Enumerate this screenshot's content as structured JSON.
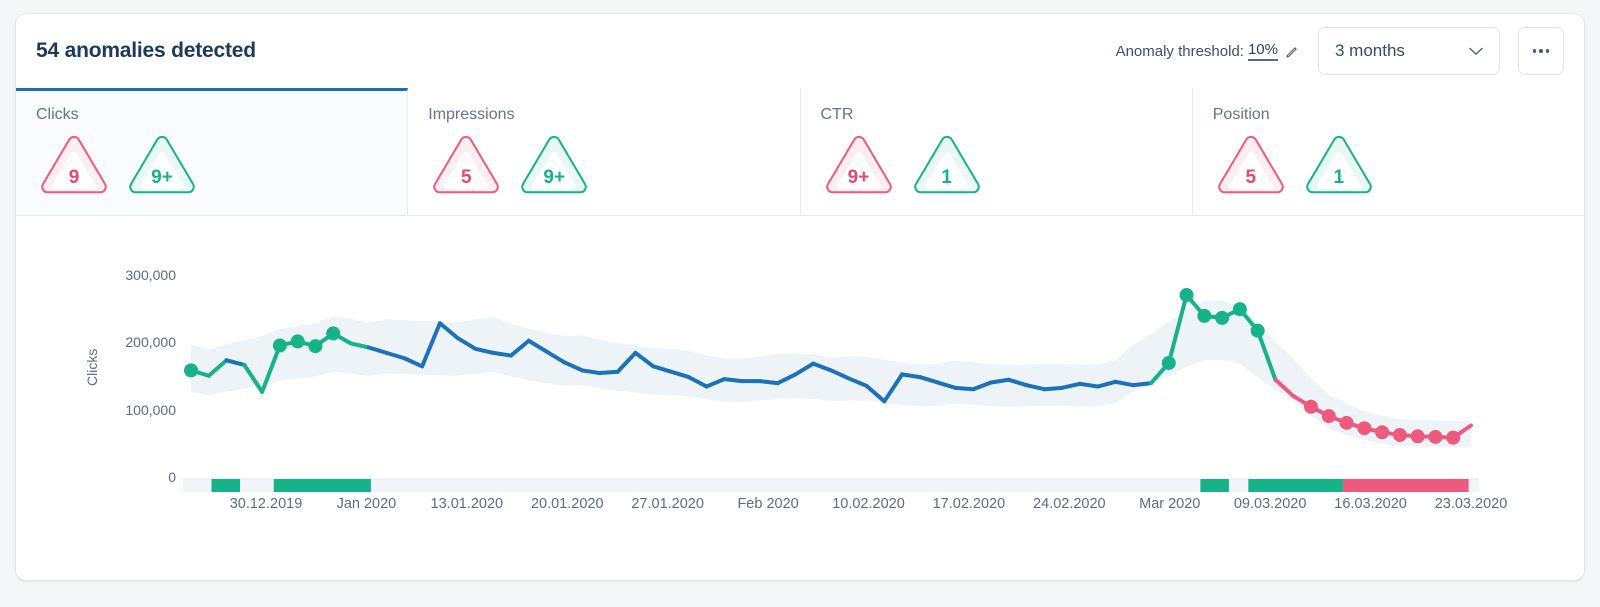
{
  "header": {
    "title": "54 anomalies detected",
    "threshold_label": "Anomaly threshold:",
    "threshold_value": "10%",
    "edit_icon": "pencil-icon",
    "period": "3 months",
    "period_caret": "chevron-down-icon",
    "more_icon": "ellipsis-icon"
  },
  "tabs": [
    {
      "label": "Clicks",
      "active": true,
      "down": "9",
      "up": "9+"
    },
    {
      "label": "Impressions",
      "active": false,
      "down": "5",
      "up": "9+"
    },
    {
      "label": "CTR",
      "active": false,
      "down": "9+",
      "up": "1"
    },
    {
      "label": "Position",
      "active": false,
      "down": "5",
      "up": "1"
    }
  ],
  "colors": {
    "line": "#1b72b8",
    "anomaly_up": "#16b288",
    "anomaly_down": "#ee5a7d",
    "band": "#eef3f8",
    "accent": "#1b6eb4",
    "title": "#1b3a5c"
  },
  "chart_data": {
    "type": "line",
    "title": "",
    "xlabel": "",
    "ylabel": "Clicks",
    "ylim": [
      0,
      330000
    ],
    "yticks": [
      0,
      100000,
      200000,
      300000
    ],
    "ytick_labels": [
      "0",
      "100,000",
      "200,000",
      "300,000"
    ],
    "xtick_labels": [
      "30.12.2019",
      "Jan 2020",
      "13.01.2020",
      "20.01.2020",
      "27.01.2020",
      "Feb 2020",
      "10.02.2020",
      "17.02.2020",
      "24.02.2020",
      "Mar 2020",
      "09.03.2020",
      "16.03.2020",
      "23.03.2020"
    ],
    "grid": false,
    "legend": null,
    "series": [
      {
        "name": "Clicks",
        "values": [
          160000,
          152000,
          175000,
          168000,
          128000,
          197000,
          203000,
          196000,
          215000,
          200000,
          194000,
          186000,
          178000,
          166000,
          230000,
          208000,
          192000,
          186000,
          182000,
          204000,
          188000,
          172000,
          160000,
          156000,
          158000,
          186000,
          166000,
          158000,
          150000,
          136000,
          147000,
          144000,
          144000,
          141000,
          154000,
          170000,
          160000,
          148000,
          137000,
          114000,
          154000,
          150000,
          142000,
          134000,
          132000,
          142000,
          146000,
          138000,
          132000,
          134000,
          140000,
          136000,
          143000,
          138000,
          141000,
          171000,
          272000,
          241000,
          238000,
          251000,
          219000,
          146000,
          122000,
          106000,
          92000,
          82000,
          74000,
          68000,
          64000,
          62000,
          61000,
          60000,
          78000
        ]
      }
    ],
    "band": {
      "name": "expected range",
      "description": "light shaded forecast band behind the line"
    },
    "anomaly_segments": [
      {
        "type": "up",
        "start_index": 4,
        "end_index": 9,
        "marker_indices": [
          5,
          6,
          7,
          8
        ]
      },
      {
        "type": "up",
        "start_index": 0,
        "end_index": 1,
        "marker_indices": [
          0
        ]
      },
      {
        "type": "up",
        "start_index": 55,
        "end_index": 61,
        "marker_indices": [
          55,
          56,
          57,
          58,
          59,
          60
        ]
      },
      {
        "type": "down",
        "start_index": 61,
        "end_index": 72,
        "marker_indices": [
          63,
          64,
          65,
          66,
          67,
          68,
          69,
          70,
          71
        ]
      }
    ],
    "status_bar": {
      "description": "anomaly strip beneath the x axis",
      "segments": [
        {
          "type": "up",
          "x_start_pct": 2.2,
          "x_end_pct": 4.4
        },
        {
          "type": "up",
          "x_start_pct": 7.0,
          "x_end_pct": 14.5
        },
        {
          "type": "up",
          "x_start_pct": 78.5,
          "x_end_pct": 80.7
        },
        {
          "type": "up",
          "x_start_pct": 82.2,
          "x_end_pct": 89.5
        },
        {
          "type": "down",
          "x_start_pct": 89.5,
          "x_end_pct": 99.2
        }
      ]
    }
  }
}
